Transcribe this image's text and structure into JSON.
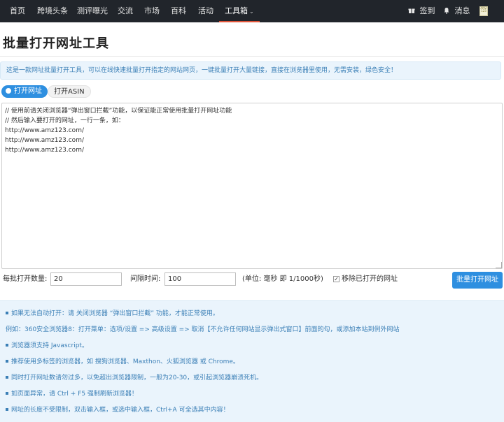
{
  "nav": {
    "items": [
      "首页",
      "跨境头条",
      "测评曝光",
      "交流",
      "市场",
      "百科",
      "活动",
      "工具箱"
    ],
    "active_caret": "⌄",
    "signin": "签到",
    "messages": "消息",
    "qr_text": "AMZ 123"
  },
  "page": {
    "title": "批量打开网址工具",
    "info": "这是一款网址批量打开工具，可以在线快速批量打开指定的网站网页，一键批量打开大量链接，直接在浏览器里使用，无需安装，绿色安全！"
  },
  "tabs": {
    "open_url": "打开网址",
    "open_asin": "打开ASIN"
  },
  "textarea": {
    "content": "// 使用前请关闭浏览器“弹出窗口拦截”功能，以保证能正常使用批量打开网址功能\n// 然后输入要打开的网址，一行一条，如：\nhttp://www.amz123.com/\nhttp://www.amz123.com/\nhttp://www.amz123.com/"
  },
  "controls": {
    "batch_label": "每批打开数量:",
    "batch_value": "20",
    "interval_label": "间隔时间:",
    "interval_value": "100",
    "unit_text": "(单位: 毫秒 即 1/1000秒)",
    "remove_opened_label": "移除已打开的网址",
    "remove_opened_checked": true,
    "submit_label": "批量打开网址"
  },
  "tips": [
    "如果无法自动打开：请 关闭浏览器 “弹出窗口拦截” 功能，才能正常使用。",
    "例如：360安全浏览器8：打开菜单：选项/设置 => 高级设置 => 取消【不允许任何网站显示弹出式窗口】前面的勾，或添加本站到例外网站",
    "浏览器须支持 Javascript。",
    "推荐使用多标签的浏览器，如 搜狗浏览器、Maxthon、火狐浏览器 或 Chrome。",
    "同时打开网址数请勿过多，以免超出浏览器限制，一般为20-30，或引起浏览器崩溃死机。",
    "如页面异常，请 Ctrl + F5 强制刷新浏览器！",
    "网址的长度不受限制，双击输入框，或选中输入框，Ctrl+A 可全选其中内容！"
  ],
  "colors": {
    "nav_bg": "#21252b",
    "accent": "#2e8fe0",
    "active_underline": "#e0553a",
    "tip_text": "#3b7fb6",
    "tip_bg": "#eaf4fc"
  }
}
